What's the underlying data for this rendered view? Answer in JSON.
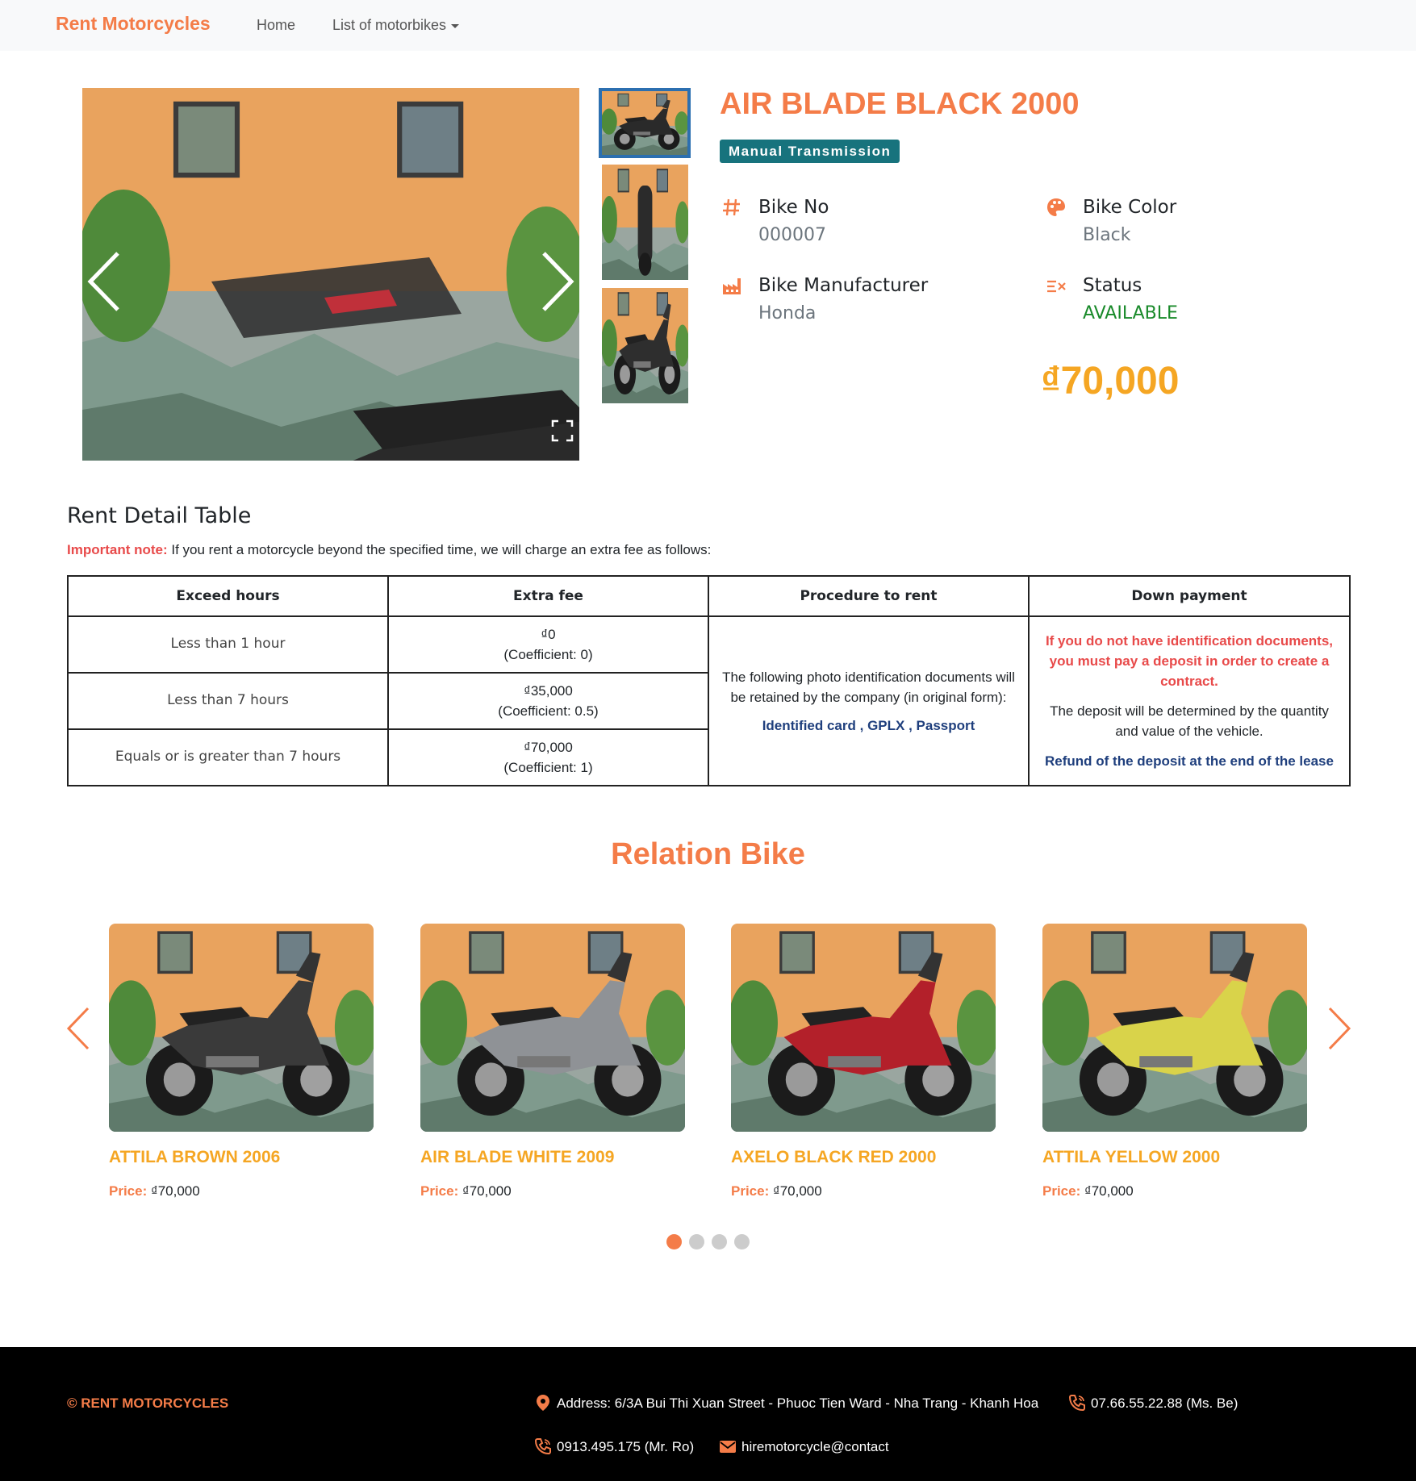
{
  "nav": {
    "brand": "Rent Motorcycles",
    "home": "Home",
    "list": "List of motorbikes"
  },
  "bike": {
    "title": "AIR BLADE BLACK 2000",
    "transmission": "Manual Transmission",
    "bike_no_label": "Bike No",
    "bike_no": "000007",
    "color_label": "Bike Color",
    "color": "Black",
    "manufacturer_label": "Bike Manufacturer",
    "manufacturer": "Honda",
    "status_label": "Status",
    "status": "AVAILABLE",
    "price": "₫70,000"
  },
  "rent": {
    "title": "Rent Detail Table",
    "note_label": "Important note:",
    "note_text": " If you rent a motorcycle beyond the specified time, we will charge an extra fee as follows:",
    "headers": [
      "Exceed hours",
      "Extra fee",
      "Procedure to rent",
      "Down payment"
    ],
    "rows": [
      {
        "hours": "Less than 1 hour",
        "fee": "₫0",
        "coef": "(Coefficient: 0)"
      },
      {
        "hours": "Less than 7 hours",
        "fee": "₫35,000",
        "coef": "(Coefficient: 0.5)"
      },
      {
        "hours": "Equals or is greater than 7 hours",
        "fee": "₫70,000",
        "coef": "(Coefficient: 1)"
      }
    ],
    "procedure_text": "The following photo identification documents will be retained by the company (in original form):",
    "doc_1": "Identified card",
    "doc_2": "GPLX",
    "doc_3": "Passport",
    "doc_sep": " , ",
    "deposit_warning": "If you do not have identification documents, you must pay a deposit in order to create a contract.",
    "deposit_text": "The deposit will be determined by the quantity and value of the vehicle.",
    "deposit_refund": "Refund of the deposit at the end of the lease"
  },
  "relation": {
    "title": "Relation Bike",
    "price_label": "Price:",
    "bikes": [
      {
        "name": "ATTILA BROWN 2006",
        "price": "₫70,000"
      },
      {
        "name": "AIR BLADE WHITE 2009",
        "price": "₫70,000"
      },
      {
        "name": "AXELO BLACK RED 2000",
        "price": "₫70,000"
      },
      {
        "name": "ATTILA YELLOW 2000",
        "price": "₫70,000"
      }
    ],
    "active_page": 1,
    "pages": 4
  },
  "footer": {
    "copyright": "© RENT MOTORCYCLES",
    "address": "Address: 6/3A Bui Thi Xuan Street - Phuoc Tien Ward - Nha Trang - Khanh Hoa",
    "phone_1": "07.66.55.22.88 (Ms. Be)",
    "phone_2": "0913.495.175 (Mr. Ro)",
    "email": "hiremotorcycle@contact"
  },
  "icons": {
    "hash": "hash-icon",
    "palette": "palette-icon",
    "factory": "factory-icon",
    "status": "status-icon",
    "location": "location-pin-icon",
    "phone": "phone-icon",
    "mail": "mail-icon",
    "fullscreen": "fullscreen-icon"
  },
  "colors": {
    "accent": "#f47c48",
    "price": "#f5a623",
    "badge": "#17737d",
    "available": "#198a2a",
    "warning": "#e84a4a",
    "link": "#1f3f7d"
  }
}
